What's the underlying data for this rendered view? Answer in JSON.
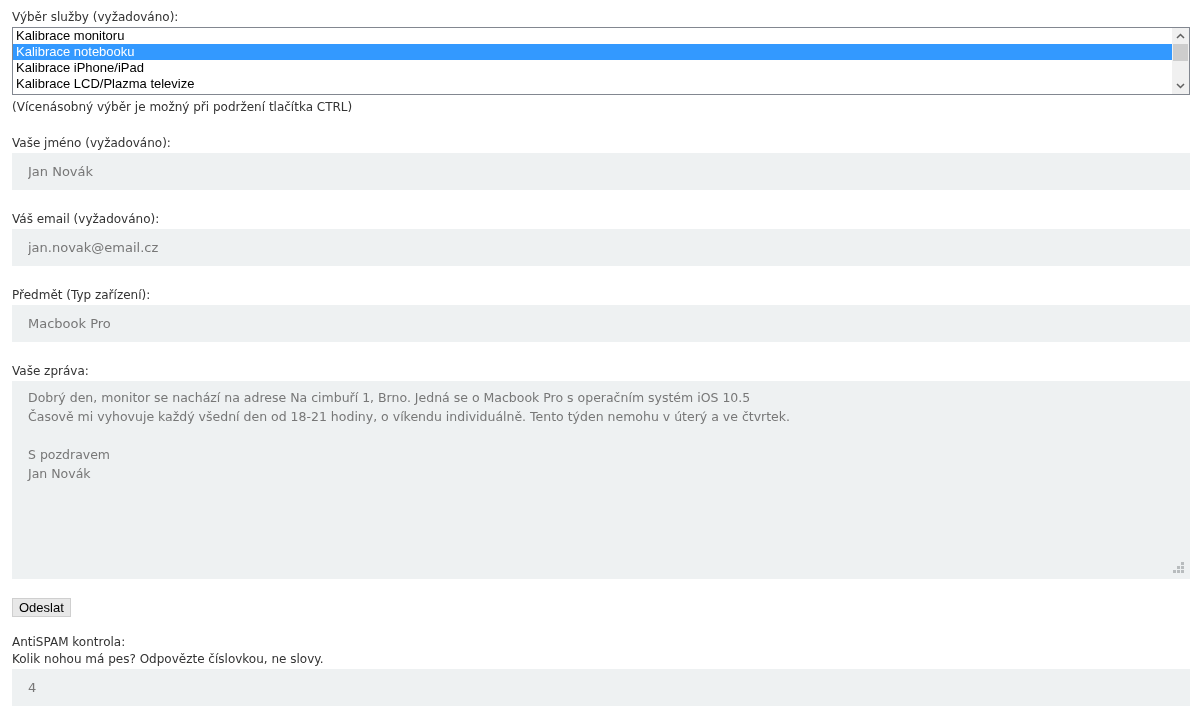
{
  "service": {
    "label": "Výběr služby (vyžadováno):",
    "options": [
      {
        "label": "Kalibrace monitoru",
        "selected": false
      },
      {
        "label": "Kalibrace notebooku",
        "selected": true
      },
      {
        "label": "Kalibrace iPhone/iPad",
        "selected": false
      },
      {
        "label": "Kalibrace LCD/Plazma televize",
        "selected": false
      }
    ],
    "hint": "(Vícenásobný výběr je možný při podržení tlačítka CTRL)"
  },
  "fields": [
    {
      "label": "Vaše jméno (vyžadováno):",
      "value": "Jan Novák"
    },
    {
      "label": "Váš email (vyžadováno):",
      "value": "jan.novak@email.cz"
    },
    {
      "label": "Předmět (Typ zařízení):",
      "value": "Macbook Pro"
    }
  ],
  "message": {
    "label": "Vaše zpráva:",
    "paragraphs": [
      [
        "Dobrý den, monitor se nachází na adrese Na cimbuří 1, Brno. Jedná se o Macbook Pro s operačním systém iOS 10.5",
        "Časově mi vyhovuje každý všední den od 18-21 hodiny, o víkendu individuálně. Tento týden nemohu v úterý a ve čtvrtek."
      ],
      [
        "S pozdravem",
        "Jan Novák"
      ]
    ]
  },
  "submit": "Odeslat",
  "antispam": {
    "label": "AntiSPAM kontrola:",
    "question": "Kolik nohou má pes? Odpovězte číslovkou, ne slovy.",
    "value": "4"
  }
}
